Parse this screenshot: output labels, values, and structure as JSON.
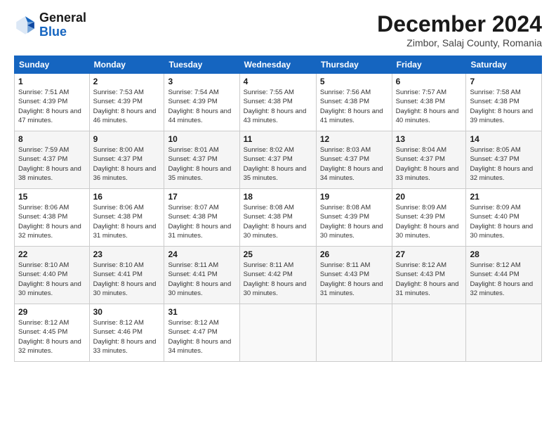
{
  "header": {
    "logo": {
      "line1": "General",
      "line2": "Blue"
    },
    "title": "December 2024",
    "subtitle": "Zimbor, Salaj County, Romania"
  },
  "weekdays": [
    "Sunday",
    "Monday",
    "Tuesday",
    "Wednesday",
    "Thursday",
    "Friday",
    "Saturday"
  ],
  "weeks": [
    [
      {
        "day": "1",
        "sunrise": "7:51 AM",
        "sunset": "4:39 PM",
        "daylight": "8 hours and 47 minutes."
      },
      {
        "day": "2",
        "sunrise": "7:53 AM",
        "sunset": "4:39 PM",
        "daylight": "8 hours and 46 minutes."
      },
      {
        "day": "3",
        "sunrise": "7:54 AM",
        "sunset": "4:39 PM",
        "daylight": "8 hours and 44 minutes."
      },
      {
        "day": "4",
        "sunrise": "7:55 AM",
        "sunset": "4:38 PM",
        "daylight": "8 hours and 43 minutes."
      },
      {
        "day": "5",
        "sunrise": "7:56 AM",
        "sunset": "4:38 PM",
        "daylight": "8 hours and 41 minutes."
      },
      {
        "day": "6",
        "sunrise": "7:57 AM",
        "sunset": "4:38 PM",
        "daylight": "8 hours and 40 minutes."
      },
      {
        "day": "7",
        "sunrise": "7:58 AM",
        "sunset": "4:38 PM",
        "daylight": "8 hours and 39 minutes."
      }
    ],
    [
      {
        "day": "8",
        "sunrise": "7:59 AM",
        "sunset": "4:37 PM",
        "daylight": "8 hours and 38 minutes."
      },
      {
        "day": "9",
        "sunrise": "8:00 AM",
        "sunset": "4:37 PM",
        "daylight": "8 hours and 36 minutes."
      },
      {
        "day": "10",
        "sunrise": "8:01 AM",
        "sunset": "4:37 PM",
        "daylight": "8 hours and 35 minutes."
      },
      {
        "day": "11",
        "sunrise": "8:02 AM",
        "sunset": "4:37 PM",
        "daylight": "8 hours and 35 minutes."
      },
      {
        "day": "12",
        "sunrise": "8:03 AM",
        "sunset": "4:37 PM",
        "daylight": "8 hours and 34 minutes."
      },
      {
        "day": "13",
        "sunrise": "8:04 AM",
        "sunset": "4:37 PM",
        "daylight": "8 hours and 33 minutes."
      },
      {
        "day": "14",
        "sunrise": "8:05 AM",
        "sunset": "4:37 PM",
        "daylight": "8 hours and 32 minutes."
      }
    ],
    [
      {
        "day": "15",
        "sunrise": "8:06 AM",
        "sunset": "4:38 PM",
        "daylight": "8 hours and 32 minutes."
      },
      {
        "day": "16",
        "sunrise": "8:06 AM",
        "sunset": "4:38 PM",
        "daylight": "8 hours and 31 minutes."
      },
      {
        "day": "17",
        "sunrise": "8:07 AM",
        "sunset": "4:38 PM",
        "daylight": "8 hours and 31 minutes."
      },
      {
        "day": "18",
        "sunrise": "8:08 AM",
        "sunset": "4:38 PM",
        "daylight": "8 hours and 30 minutes."
      },
      {
        "day": "19",
        "sunrise": "8:08 AM",
        "sunset": "4:39 PM",
        "daylight": "8 hours and 30 minutes."
      },
      {
        "day": "20",
        "sunrise": "8:09 AM",
        "sunset": "4:39 PM",
        "daylight": "8 hours and 30 minutes."
      },
      {
        "day": "21",
        "sunrise": "8:09 AM",
        "sunset": "4:40 PM",
        "daylight": "8 hours and 30 minutes."
      }
    ],
    [
      {
        "day": "22",
        "sunrise": "8:10 AM",
        "sunset": "4:40 PM",
        "daylight": "8 hours and 30 minutes."
      },
      {
        "day": "23",
        "sunrise": "8:10 AM",
        "sunset": "4:41 PM",
        "daylight": "8 hours and 30 minutes."
      },
      {
        "day": "24",
        "sunrise": "8:11 AM",
        "sunset": "4:41 PM",
        "daylight": "8 hours and 30 minutes."
      },
      {
        "day": "25",
        "sunrise": "8:11 AM",
        "sunset": "4:42 PM",
        "daylight": "8 hours and 30 minutes."
      },
      {
        "day": "26",
        "sunrise": "8:11 AM",
        "sunset": "4:43 PM",
        "daylight": "8 hours and 31 minutes."
      },
      {
        "day": "27",
        "sunrise": "8:12 AM",
        "sunset": "4:43 PM",
        "daylight": "8 hours and 31 minutes."
      },
      {
        "day": "28",
        "sunrise": "8:12 AM",
        "sunset": "4:44 PM",
        "daylight": "8 hours and 32 minutes."
      }
    ],
    [
      {
        "day": "29",
        "sunrise": "8:12 AM",
        "sunset": "4:45 PM",
        "daylight": "8 hours and 32 minutes."
      },
      {
        "day": "30",
        "sunrise": "8:12 AM",
        "sunset": "4:46 PM",
        "daylight": "8 hours and 33 minutes."
      },
      {
        "day": "31",
        "sunrise": "8:12 AM",
        "sunset": "4:47 PM",
        "daylight": "8 hours and 34 minutes."
      },
      null,
      null,
      null,
      null
    ]
  ],
  "labels": {
    "sunrise": "Sunrise:",
    "sunset": "Sunset:",
    "daylight": "Daylight:"
  }
}
